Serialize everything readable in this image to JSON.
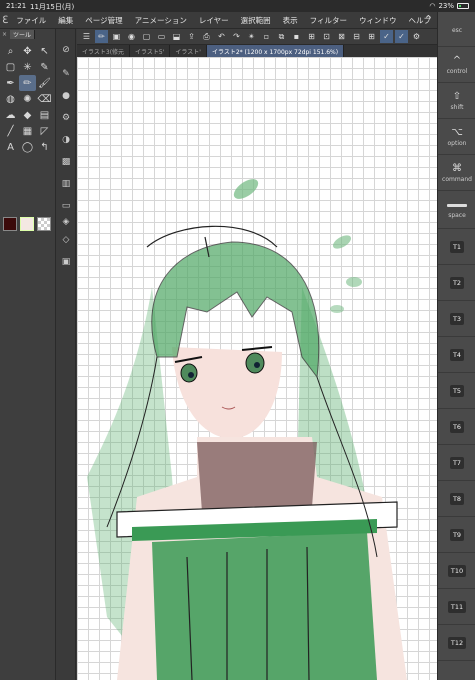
{
  "status": {
    "time": "21:21",
    "date": "11月15日(月)",
    "battery": "23%"
  },
  "menu": [
    "ファイル",
    "編集",
    "ページ管理",
    "アニメーション",
    "レイヤー",
    "選択範囲",
    "表示",
    "フィルター",
    "ウィンドウ",
    "ヘルプ"
  ],
  "tool_panel": {
    "tab_label": "ツール"
  },
  "tabs": [
    "イラスト3(修元",
    "イラスト5'",
    "イラスト'",
    "イラスト2* (1200 x 1700px 72dpi 151.6%)"
  ],
  "keys": [
    {
      "symbol": "",
      "label": "esc"
    },
    {
      "symbol": "^",
      "label": "control"
    },
    {
      "symbol": "⇧",
      "label": "shift"
    },
    {
      "symbol": "⌥",
      "label": "option"
    },
    {
      "symbol": "⌘",
      "label": "command"
    },
    {
      "symbol": "",
      "label": "space"
    },
    {
      "label": "T1"
    },
    {
      "label": "T2"
    },
    {
      "label": "T3"
    },
    {
      "label": "T4"
    },
    {
      "label": "T5"
    },
    {
      "label": "T6"
    },
    {
      "label": "T7"
    },
    {
      "label": "T8"
    },
    {
      "label": "T9"
    },
    {
      "label": "T10"
    },
    {
      "label": "T11"
    },
    {
      "label": "T12"
    }
  ],
  "colors": {
    "main": "#3b0a0a",
    "sub": "#f4e8e2",
    "accent": "#4c5f80",
    "hair": "#2e8b4a"
  }
}
